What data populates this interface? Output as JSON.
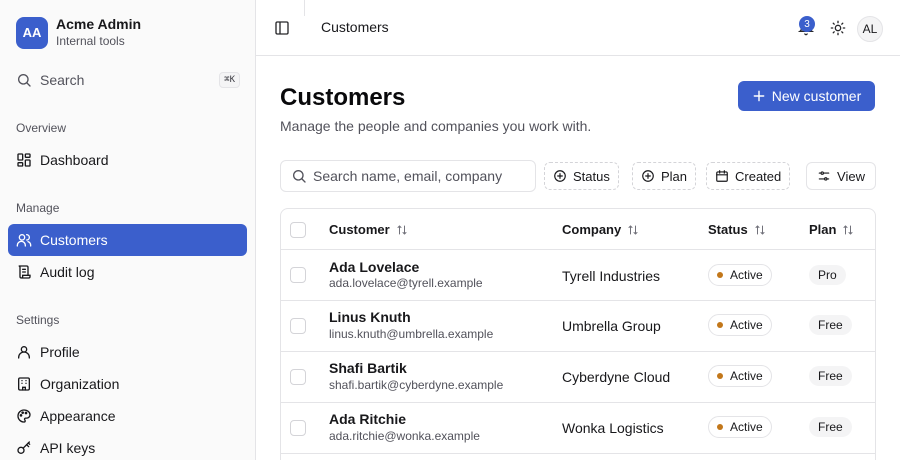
{
  "brand": {
    "initials": "AA",
    "name": "Acme Admin",
    "subtitle": "Internal tools"
  },
  "sidebar": {
    "search_label": "Search",
    "search_shortcut": "⌘K",
    "sections": [
      {
        "title": "Overview",
        "items": [
          {
            "label": "Dashboard",
            "icon": "dashboard-icon"
          }
        ]
      },
      {
        "title": "Manage",
        "items": [
          {
            "label": "Customers",
            "icon": "users-icon",
            "active": true
          },
          {
            "label": "Audit log",
            "icon": "scroll-icon"
          }
        ]
      },
      {
        "title": "Settings",
        "items": [
          {
            "label": "Profile",
            "icon": "user-icon"
          },
          {
            "label": "Organization",
            "icon": "building-icon"
          },
          {
            "label": "Appearance",
            "icon": "palette-icon"
          },
          {
            "label": "API keys",
            "icon": "key-icon"
          }
        ]
      }
    ]
  },
  "topbar": {
    "breadcrumb": "Customers",
    "notification_count": "3",
    "user_initials": "AL"
  },
  "page": {
    "title": "Customers",
    "description": "Manage the people and companies you work with.",
    "new_button": "New customer"
  },
  "toolbar": {
    "search_placeholder": "Search name, email, company",
    "filters": [
      "Status",
      "Plan",
      "Created"
    ],
    "view_label": "View"
  },
  "table": {
    "columns": [
      "Customer",
      "Company",
      "Status",
      "Plan"
    ],
    "rows": [
      {
        "name": "Ada Lovelace",
        "email": "ada.lovelace@tyrell.example",
        "company": "Tyrell Industries",
        "status": "Active",
        "plan": "Pro"
      },
      {
        "name": "Linus Knuth",
        "email": "linus.knuth@umbrella.example",
        "company": "Umbrella Group",
        "status": "Active",
        "plan": "Free"
      },
      {
        "name": "Shafi Bartik",
        "email": "shafi.bartik@cyberdyne.example",
        "company": "Cyberdyne Cloud",
        "status": "Active",
        "plan": "Free"
      },
      {
        "name": "Ada Ritchie",
        "email": "ada.ritchie@wonka.example",
        "company": "Wonka Logistics",
        "status": "Active",
        "plan": "Free"
      }
    ]
  },
  "colors": {
    "accent": "#3b5fcc",
    "status_dot": "#c2771a",
    "border": "#e4e4e7"
  }
}
